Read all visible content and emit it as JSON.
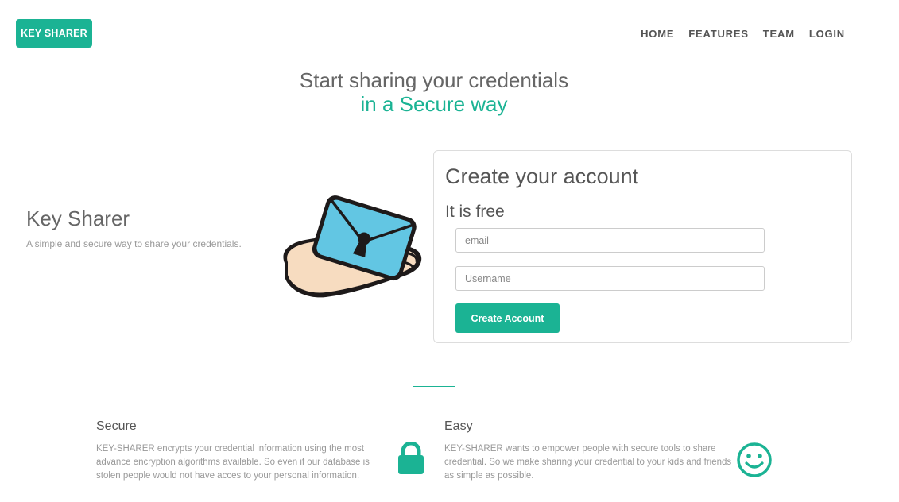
{
  "brand": {
    "label": "KEY SHARER"
  },
  "nav": {
    "items": [
      "HOME",
      "FEATURES",
      "TEAM",
      "LOGIN"
    ]
  },
  "hero": {
    "line1": "Start sharing your credentials",
    "line2": "in a Secure way"
  },
  "intro": {
    "title": "Key Sharer",
    "subtitle": "A simple and secure way to share your credentials."
  },
  "signup": {
    "title": "Create your account",
    "subtitle": "It is free",
    "email_placeholder": "email",
    "username_placeholder": "Username",
    "button_label": "Create Account"
  },
  "features": [
    {
      "title": "Secure",
      "text": "KEY-SHARER encrypts your credential information using the most advance encryption algorithms available. So even if our database is stolen people would not have acces to your personal information.",
      "icon": "lock-icon"
    },
    {
      "title": "Easy",
      "text": "KEY-SHARER wants to empower people with secure tools to share credential. So we make sharing your credential to your kids and friends as simple as possible.",
      "icon": "smile-icon"
    }
  ],
  "colors": {
    "accent": "#1bb394",
    "envelope": "#62c6e3",
    "hand": "#f7dcc0"
  }
}
